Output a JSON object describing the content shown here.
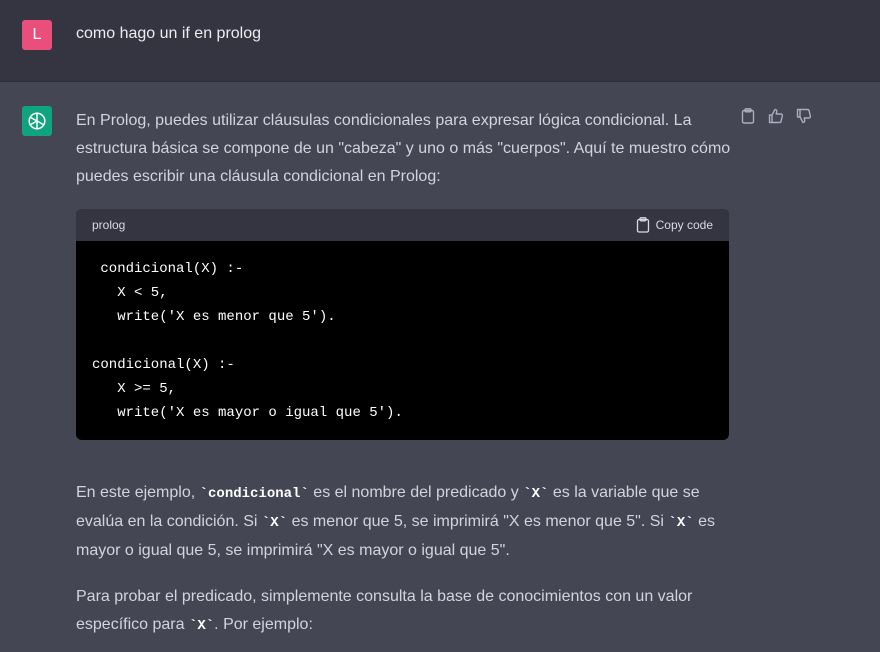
{
  "user": {
    "avatar_letter": "L",
    "message": "como hago un if en prolog"
  },
  "assistant": {
    "intro": "En Prolog, puedes utilizar cláusulas condicionales para expresar lógica condicional. La estructura básica se compone de un \"cabeza\" y uno o más \"cuerpos\". Aquí te muestro cómo puedes escribir una cláusula condicional en Prolog:",
    "code_block": {
      "language": "prolog",
      "copy_label": "Copy code",
      "code": " condicional(X) :-\n   X < 5,\n   write('X es menor que 5').\n\ncondicional(X) :-\n   X >= 5,\n   write('X es mayor o igual que 5')."
    },
    "para2": {
      "a": "En este ejemplo, ",
      "code1": "`condicional`",
      "b": " es el nombre del predicado y ",
      "code2": "`X`",
      "c": " es la variable que se evalúa en la condición. Si ",
      "code3": "`X`",
      "d": " es menor que 5, se imprimirá \"X es menor que 5\". Si ",
      "code4": "`X`",
      "e": " es mayor o igual que 5, se imprimirá \"X es mayor o igual que 5\"."
    },
    "para3": {
      "a": "Para probar el predicado, simplemente consulta la base de conocimientos con un valor específico para ",
      "code1": "`X`",
      "b": ". Por ejemplo:"
    }
  },
  "colors": {
    "user_bg": "#343541",
    "assistant_bg": "#444654",
    "user_avatar": "#e94f7a",
    "bot_avatar": "#10a37f"
  }
}
